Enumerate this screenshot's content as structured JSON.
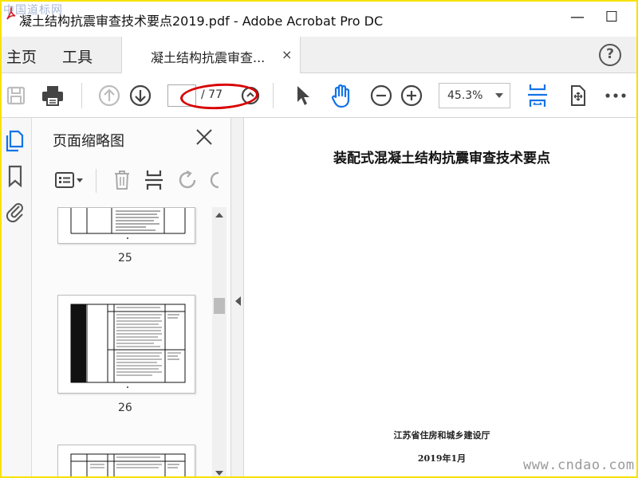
{
  "window": {
    "title": "凝土结构抗震审查技术要点2019.pdf - Adobe Acrobat Pro DC",
    "minimize": "—",
    "maximize": "☐",
    "watermark_top": "中国道标网"
  },
  "tabs": {
    "home": "主页",
    "tools": "工具",
    "document": "凝土结构抗震审查...",
    "close": "×",
    "help": "?"
  },
  "toolbar": {
    "page_current": "",
    "page_total": "/ 77",
    "zoom": "45.3%",
    "icons": [
      "save-icon",
      "print-icon",
      "prev-page-icon",
      "next-page-icon",
      "select-cursor-icon",
      "hand-tool-icon",
      "zoom-out-icon",
      "zoom-in-icon",
      "fit-page-icon",
      "full-screen-icon",
      "more-icon"
    ],
    "accent": "#1473e6",
    "highlight": "#d80000"
  },
  "panel": {
    "title": "页面缩略图",
    "thumbnails": [
      {
        "page": "25"
      },
      {
        "page": "26"
      },
      {
        "page": ""
      }
    ]
  },
  "document": {
    "title": "装配式混凝土结构抗震审查技术要点",
    "org": "江苏省住房和城乡建设厅",
    "date": "2019年1月"
  },
  "watermark_bottom": "www.cndao.com"
}
